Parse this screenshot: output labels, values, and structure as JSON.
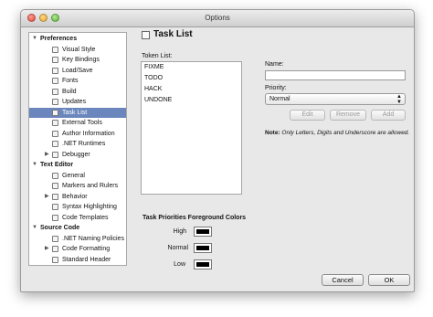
{
  "window": {
    "title": "Options"
  },
  "sidebar": {
    "rows": [
      {
        "type": "cat",
        "label": "Preferences",
        "expanded": true
      },
      {
        "type": "item",
        "label": "Visual Style"
      },
      {
        "type": "item",
        "label": "Key Bindings"
      },
      {
        "type": "item",
        "label": "Load/Save"
      },
      {
        "type": "item",
        "label": "Fonts"
      },
      {
        "type": "item",
        "label": "Build"
      },
      {
        "type": "item",
        "label": "Updates"
      },
      {
        "type": "item",
        "label": "Task List",
        "selected": true
      },
      {
        "type": "item",
        "label": "External Tools"
      },
      {
        "type": "item",
        "label": "Author Information"
      },
      {
        "type": "item",
        "label": ".NET Runtimes"
      },
      {
        "type": "item",
        "label": "Debugger",
        "collapsed": true
      },
      {
        "type": "cat",
        "label": "Text Editor",
        "expanded": true
      },
      {
        "type": "item",
        "label": "General"
      },
      {
        "type": "item",
        "label": "Markers and Rulers"
      },
      {
        "type": "item",
        "label": "Behavior",
        "collapsed": true
      },
      {
        "type": "item",
        "label": "Syntax Highlighting"
      },
      {
        "type": "item",
        "label": "Code Templates"
      },
      {
        "type": "cat",
        "label": "Source Code",
        "expanded": true
      },
      {
        "type": "item",
        "label": ".NET Naming Policies"
      },
      {
        "type": "item",
        "label": "Code Formatting",
        "collapsed": true
      },
      {
        "type": "item",
        "label": "Standard Header"
      }
    ]
  },
  "panel": {
    "title": "Task List",
    "token_list_label": "Token List:",
    "tokens": [
      "FIXME",
      "TODO",
      "HACK",
      "UNDONE"
    ],
    "name_label": "Name:",
    "name_value": "",
    "priority_label": "Priority:",
    "priority_value": "Normal",
    "buttons": {
      "edit": "Edit",
      "remove": "Remove",
      "add": "Add"
    },
    "note_bold": "Note:",
    "note_text": " Only Letters, Digits and Underscore are allowed.",
    "colors_title": "Task Priorities Foreground Colors",
    "priority_colors": [
      {
        "label": "High",
        "color": "#000000"
      },
      {
        "label": "Normal",
        "color": "#000000"
      },
      {
        "label": "Low",
        "color": "#000000"
      }
    ]
  },
  "footer": {
    "cancel": "Cancel",
    "ok": "OK"
  }
}
